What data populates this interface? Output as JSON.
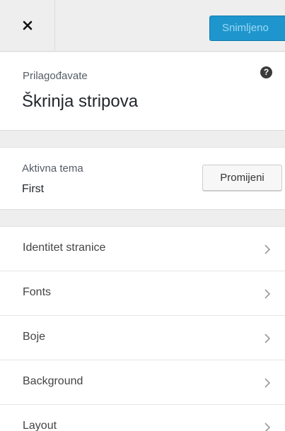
{
  "header": {
    "close_icon": "close-icon",
    "save_label": "Snimljeno"
  },
  "info": {
    "label": "Prilagođavate",
    "title": "Škrinja stripova",
    "help_icon": "help-icon",
    "help_glyph": "?"
  },
  "theme": {
    "label": "Aktivna tema",
    "name": "First",
    "change_label": "Promijeni"
  },
  "menu": {
    "items": [
      {
        "label": "Identitet stranice",
        "icon": "chevron-right-icon"
      },
      {
        "label": "Fonts",
        "icon": "chevron-right-icon"
      },
      {
        "label": "Boje",
        "icon": "chevron-right-icon"
      },
      {
        "label": "Background",
        "icon": "chevron-right-icon"
      },
      {
        "label": "Layout",
        "icon": "chevron-right-icon"
      }
    ]
  },
  "colors": {
    "accent": "#1e96cd",
    "panel_bg": "#eeeeee",
    "section_bg": "#ffffff"
  }
}
